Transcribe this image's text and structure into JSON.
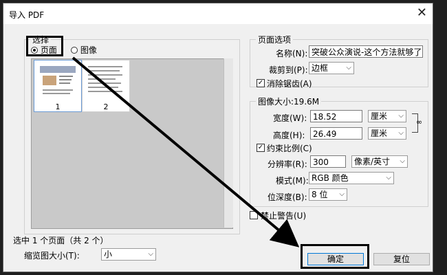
{
  "window": {
    "title": "导入 PDF",
    "close_glyph": "✕"
  },
  "select_section": {
    "legend": "选择",
    "radio_page": "页面",
    "radio_image": "图像",
    "selected": "页面",
    "thumbnails": [
      {
        "number": "1",
        "selected": true
      },
      {
        "number": "2",
        "selected": false
      }
    ],
    "status": "选中 1 个页面（共 2 个）",
    "thumb_size_label": "缩览图大小(T):",
    "thumb_size_value": "小"
  },
  "page_options": {
    "legend": "页面选项",
    "name_label": "名称(N):",
    "name_value": "突破公众演说-这个方法就够了",
    "crop_label": "裁剪到(P):",
    "crop_value": "边框",
    "anti_alias_label": "消除锯齿(A)",
    "anti_alias_checked": true
  },
  "image_size": {
    "legend": "图像大小:19.6M",
    "width_label": "宽度(W):",
    "width_value": "18.52",
    "width_unit": "厘米",
    "height_label": "高度(H):",
    "height_value": "26.49",
    "height_unit": "厘米",
    "constrain_label": "约束比例(C)",
    "constrain_checked": true,
    "resolution_label": "分辨率(R):",
    "resolution_value": "300",
    "resolution_unit": "像素/英寸",
    "mode_label": "模式(M):",
    "mode_value": "RGB 颜色",
    "depth_label": "位深度(B):",
    "depth_value": "8 位"
  },
  "suppress_warnings_label": "禁止警告(U)",
  "buttons": {
    "ok": "确定",
    "reset": "复位"
  },
  "annotation_color": "#000000"
}
